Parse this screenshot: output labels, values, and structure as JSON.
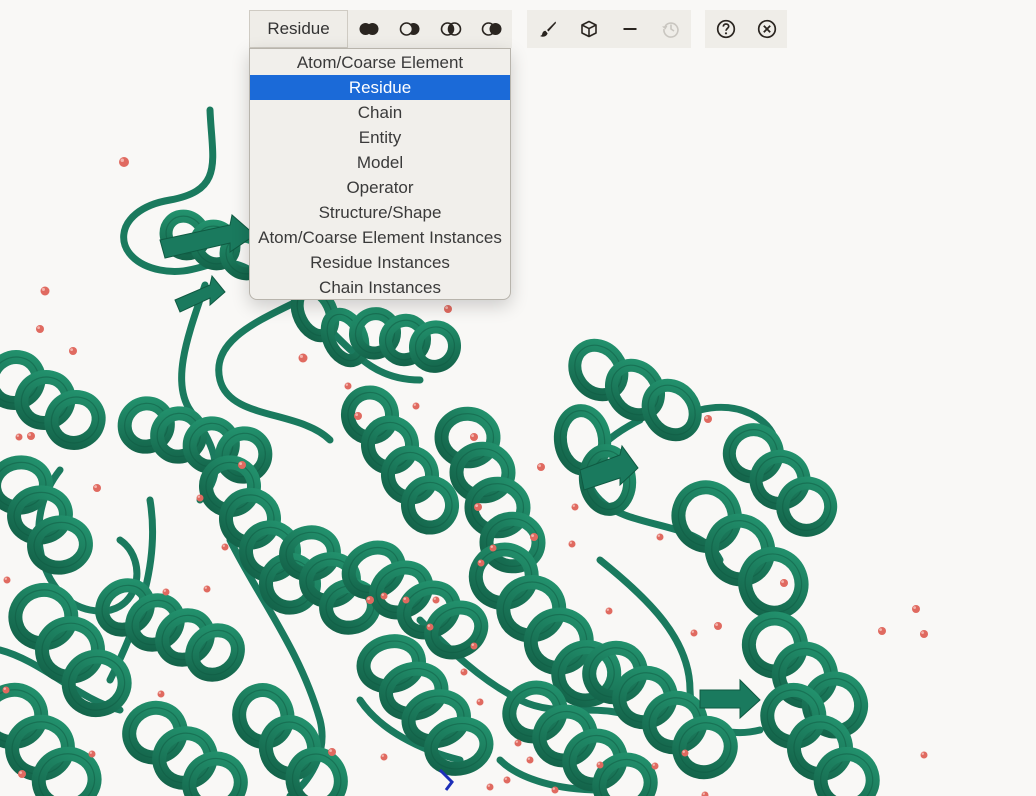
{
  "toolbar": {
    "granularity_label": "Residue",
    "buttons": [
      {
        "name": "select-union-button",
        "icon": "venn-union-icon"
      },
      {
        "name": "select-subtract-button",
        "icon": "venn-subtract-icon"
      },
      {
        "name": "select-intersect-button",
        "icon": "venn-intersect-icon"
      },
      {
        "name": "select-set-button",
        "icon": "venn-set-icon"
      },
      {
        "name": "color-button",
        "icon": "paintbrush-icon"
      },
      {
        "name": "representation-button",
        "icon": "cube-icon"
      },
      {
        "name": "remove-button",
        "icon": "minus-icon"
      },
      {
        "name": "undo-button",
        "icon": "history-icon",
        "disabled": true
      },
      {
        "name": "help-button",
        "icon": "question-circle-icon"
      },
      {
        "name": "close-button",
        "icon": "close-circle-icon"
      }
    ]
  },
  "dropdown": {
    "selected": "Residue",
    "options": [
      "Atom/Coarse Element",
      "Residue",
      "Chain",
      "Entity",
      "Model",
      "Operator",
      "Structure/Shape",
      "Atom/Coarse Element Instances",
      "Residue Instances",
      "Chain Instances"
    ]
  },
  "colors": {
    "background": "#f9f8f6",
    "ribbon": "#1a7a5e",
    "water": "#e06a60",
    "accent": "#1b6ad8"
  }
}
